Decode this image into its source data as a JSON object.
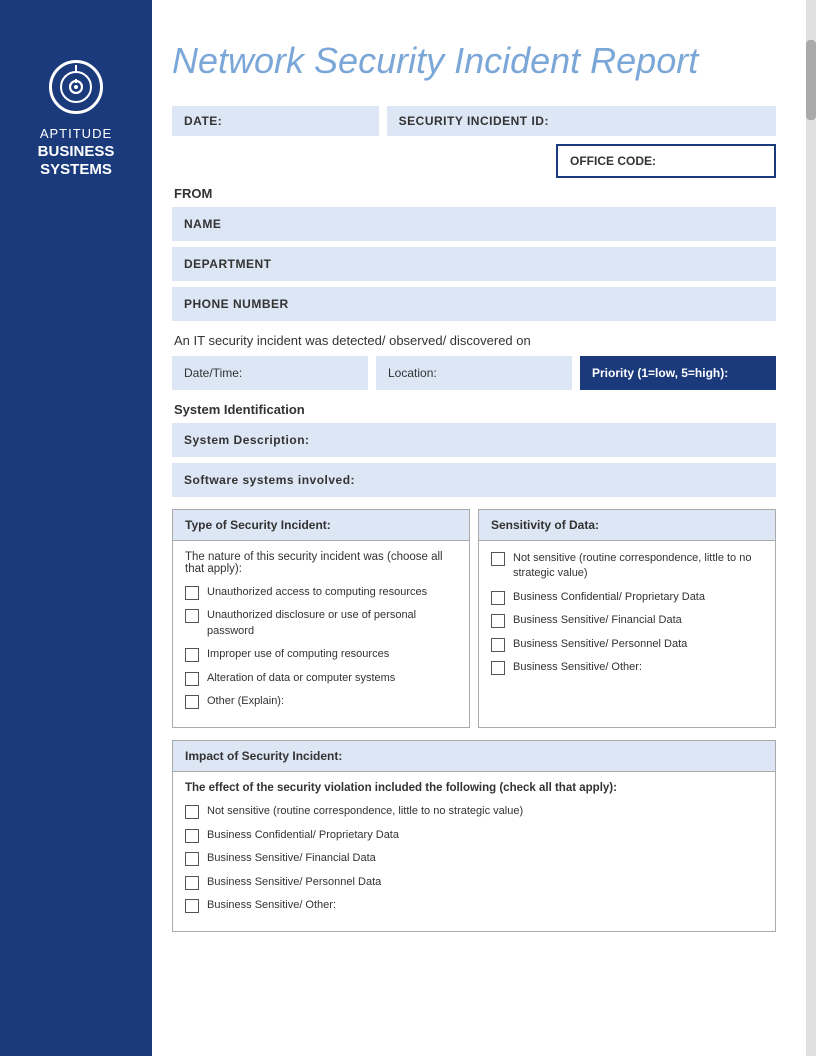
{
  "sidebar": {
    "aptitude_label": "APTITUDE",
    "business_label": "BUSINESS",
    "systems_label": "SYSTEMS"
  },
  "header": {
    "title": "Network Security Incident Report"
  },
  "form": {
    "date_label": "DATE:",
    "security_incident_id_label": "SECURITY INCIDENT ID:",
    "office_code_label": "OFFICE CODE:",
    "from_label": "FROM",
    "name_label": "NAME",
    "department_label": "DEPARTMENT",
    "phone_label": "PHONE NUMBER",
    "detected_text": "An IT security incident was detected/ observed/ discovered on",
    "date_time_label": "Date/Time:",
    "location_label": "Location:",
    "priority_label": "Priority (1=low, 5=high):",
    "system_id_label": "System Identification",
    "system_desc_label": "System Description:",
    "software_label": "Software systems involved:",
    "incident_type_header": "Type of Security Incident:",
    "incident_type_body_title": "The nature of this security incident was (choose all that apply):",
    "incident_checkboxes": [
      "Unauthorized access to computing resources",
      "Unauthorized disclosure or use of personal password",
      "Improper use of computing resources",
      "Alteration of data or computer systems",
      "Other (Explain):"
    ],
    "sensitivity_header": "Sensitivity of Data:",
    "sensitivity_checkboxes": [
      "Not sensitive (routine correspondence, little to no strategic value)",
      "Business Confidential/ Proprietary Data",
      "Business Sensitive/ Financial Data",
      "Business Sensitive/ Personnel Data",
      "Business Sensitive/ Other:"
    ],
    "impact_header": "Impact of Security Incident:",
    "impact_body_title": "The effect of the security violation included the following (check all that apply):",
    "impact_checkboxes": [
      "Not sensitive (routine correspondence, little to no strategic value)",
      "Business Confidential/ Proprietary Data",
      "Business Sensitive/ Financial Data",
      "Business Sensitive/ Personnel Data",
      "Business Sensitive/ Other:"
    ]
  }
}
